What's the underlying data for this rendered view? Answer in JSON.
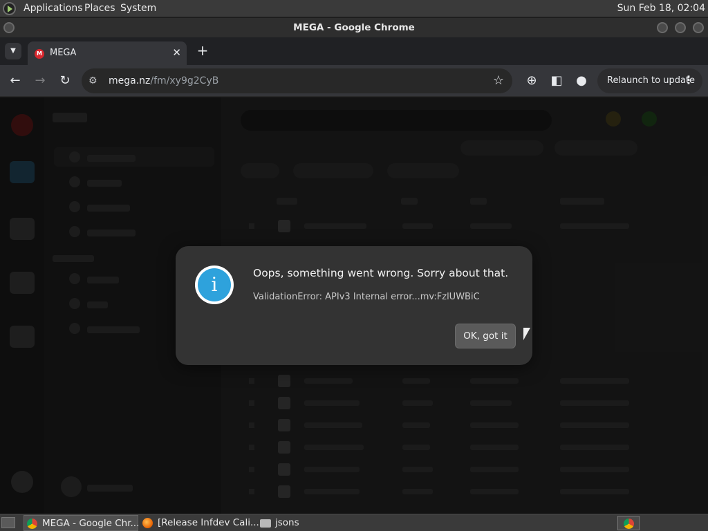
{
  "top_panel": {
    "menus": [
      "Applications",
      "Places",
      "System"
    ],
    "clock": "Sun Feb 18, 02:04"
  },
  "window": {
    "title": "MEGA - Google Chrome"
  },
  "tabs": [
    {
      "label": "MEGA",
      "favicon": "mega-logo-icon",
      "close": "✕"
    }
  ],
  "toolbar": {
    "url_host": "mega.nz",
    "url_path": "/fm/xy9g2CyB",
    "relaunch_label": "Relaunch to update",
    "new_tab": "+",
    "back": "←",
    "forward": "→",
    "reload": "↻",
    "star": "☆",
    "menu_dots": "⋮"
  },
  "dialog": {
    "icon": "info-icon",
    "icon_glyph": "i",
    "title": "Oops, something went wrong. Sorry about that.",
    "detail": "ValidationError: APIv3 Internal error...mv:FzlUWBiC",
    "ok_label": "OK, got it",
    "accent_color": "#2ea2dc"
  },
  "taskbar": {
    "tasks": [
      {
        "label": "MEGA - Google Chr...",
        "icon": "chrome-icon",
        "active": true
      },
      {
        "label": "[Release Infdev Cali...",
        "icon": "firefox-icon",
        "active": false
      },
      {
        "label": "jsons",
        "icon": "folder-icon",
        "active": false
      }
    ]
  }
}
